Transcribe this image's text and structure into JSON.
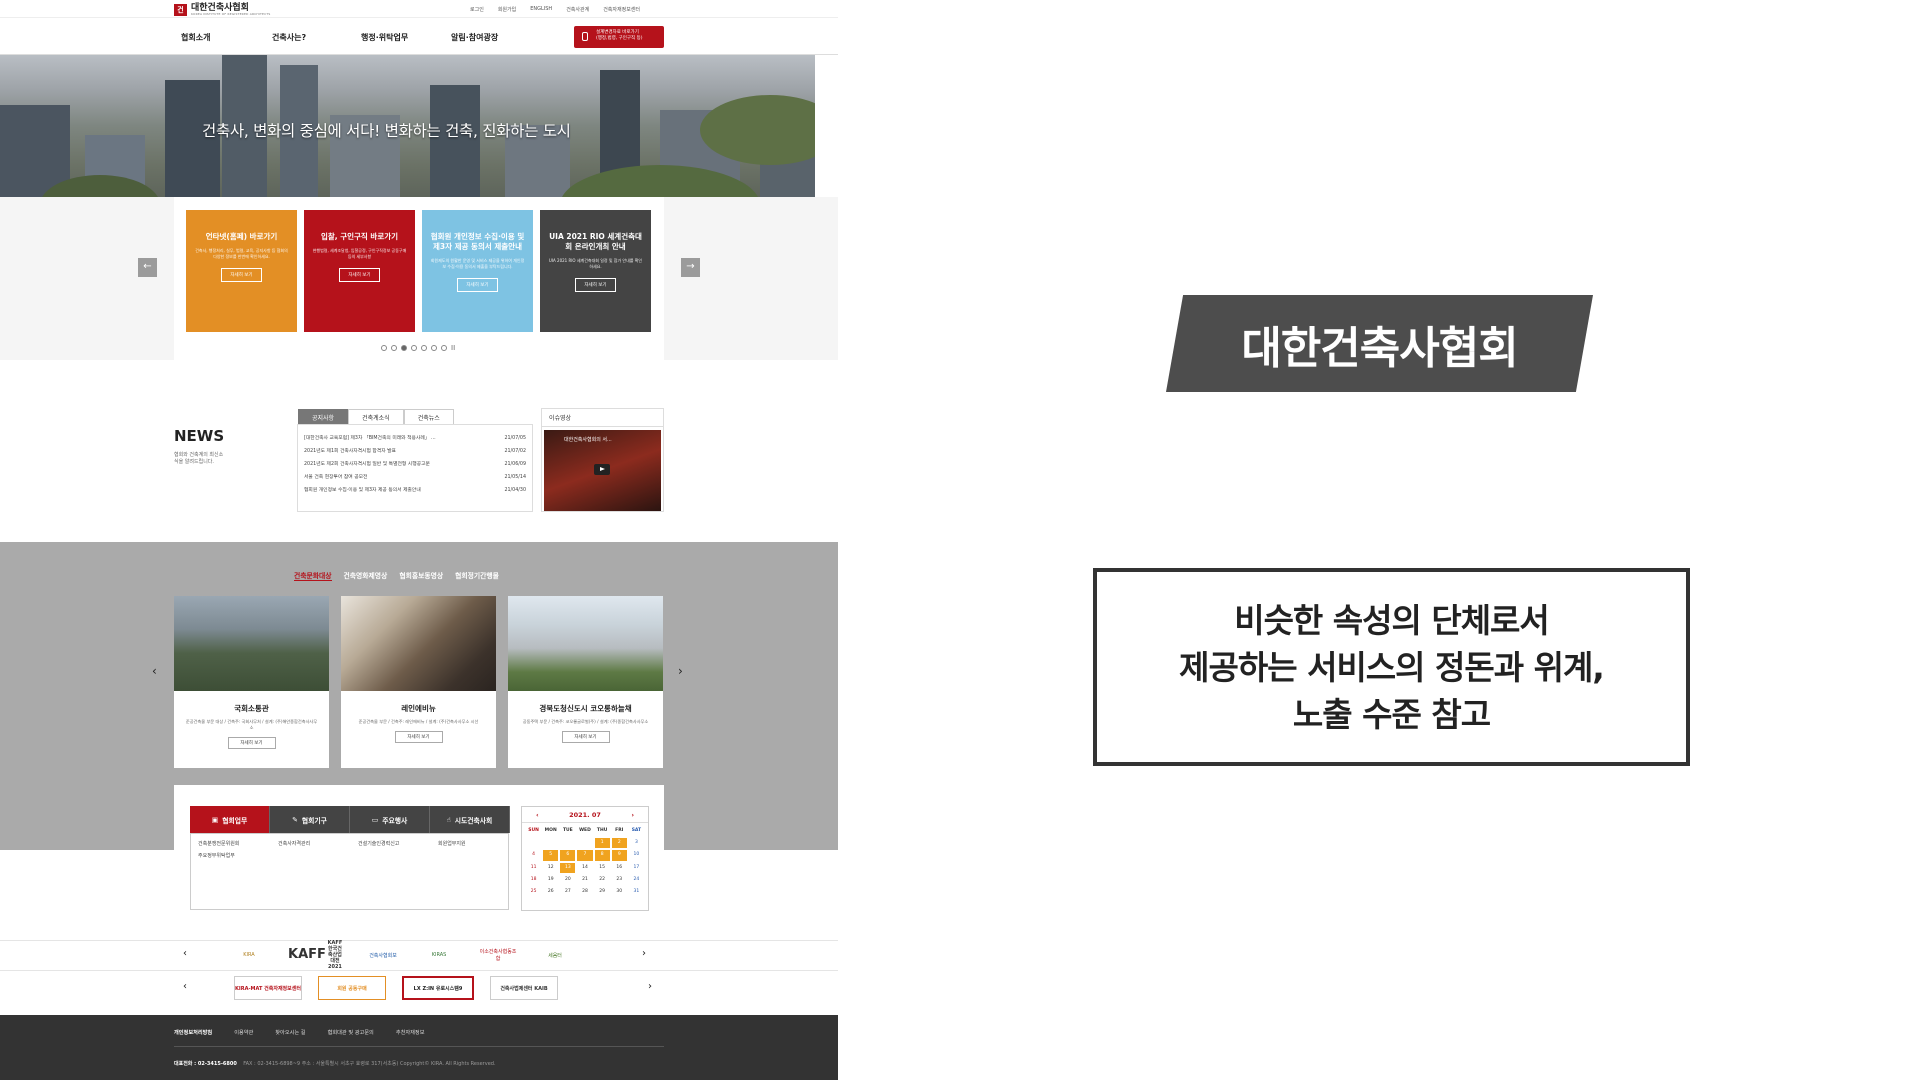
{
  "header": {
    "logo_title": "대한건축사협회",
    "logo_sub": "KOREA INSTITUTE OF REGISTERED ARCHITECTS",
    "utils": [
      "로그인",
      "회원가입",
      "ENGLISH",
      "건축사관계",
      "건축자재정보센터"
    ],
    "gnb": [
      "협회소개",
      "건축사는?",
      "행정·위탁업무",
      "알림·참여광장"
    ],
    "cta_line1": "설계변경자료 바로가기",
    "cta_line2": "(행정,법령, 구인구직 등)"
  },
  "hero": {
    "text": "건축사, 변화의 중심에 서다! 변화하는 건축, 진화하는 도시"
  },
  "cards": [
    {
      "title": "언타넷(홈페) 바로가기",
      "desc": "건축사, 행정처리, 실무, 법령, 교육, 공지사항 등 협회의 다양한 정보를 한번에 확인하세요.",
      "btn": "자세히 보기",
      "color": "#e38f25"
    },
    {
      "title": "입찰, 구인구직 바로가기",
      "desc": "현행법령, 세계조달청, 입찰공정, 구인구직정보 공동구매 등의 세부사항",
      "btn": "자세히 보기",
      "color": "#b5121b"
    },
    {
      "title": "협회원 개인정보 수집·이용 및 제3자 제공 동의서 제출안내",
      "desc": "회원제도의 원활한 운영 및 서비스 제공을 위하여 개인정보 수집·이용 동의서 제출을 부탁드립니다.",
      "btn": "자세히 보기",
      "color": "#7ec3e3"
    },
    {
      "title": "UIA 2021 RIO 세계건축대회 온라인개최 안내",
      "desc": "UIA 2021 RIO 세계건축대회 일정 및 참가 안내를 확인하세요.",
      "btn": "자세히 보기",
      "color": "#444444"
    }
  ],
  "slider": {
    "prev": "←",
    "next": "→",
    "pause": "II"
  },
  "news": {
    "heading": "NEWS",
    "desc": "협회와 건축계의 최신소식을 알려드립니다.",
    "tabs": [
      "공지사항",
      "건축계소식",
      "건축뉴스"
    ],
    "items": [
      {
        "title": "[대한건축사 교육포럼] 제3차 「BIM건축의 미래와 적용사례」 ...",
        "date": "21/07/05"
      },
      {
        "title": "2021년도 제1회 건축사자격시험 합격자 발표",
        "date": "21/07/02"
      },
      {
        "title": "2021년도 제2회 건축사자격시험 일반 및 특별전형 시행공고문",
        "date": "21/06/09"
      },
      {
        "title": "서울 건축 현장투어 참여 공모전",
        "date": "21/05/14"
      },
      {
        "title": "협회원 개인정보 수집·이용 및 제3자 제공 동의서 제출안내",
        "date": "21/04/30"
      }
    ],
    "issue_heading": "이슈영상",
    "video_title": "대한건축사협회의 서..."
  },
  "culture": {
    "tabs": [
      "건축문화대상",
      "건축영화제영상",
      "협회홍보동영상",
      "협회정기간행물"
    ],
    "cards": [
      {
        "title": "국회소통관",
        "desc": "준공건축물 부문 대상 / 건축주: 국회사무처 / 설계: (주)해안종합건축사사무소",
        "btn": "자세히 보기"
      },
      {
        "title": "레인에비뉴",
        "desc": "준공건축물 부문 / 건축주: 레인에비뉴 / 설계: (주)건축사사무소 시선",
        "btn": "자세히 보기"
      },
      {
        "title": "경북도청신도시 코오롱하늘채",
        "desc": "공동주택 부문 / 건축주: 코오롱글로벌(주) / 설계: (주)종합건축사사무소",
        "btn": "자세히 보기"
      }
    ],
    "prev": "‹",
    "next": "›"
  },
  "business": {
    "tabs": [
      "협회업무",
      "협회기구",
      "주요행사",
      "시도건축사회"
    ],
    "items": [
      "건축분쟁전문위원회",
      "건축사자격관리",
      "건설기술인경력신고",
      "회원업무지원",
      "주요정부위탁업무"
    ],
    "calendar": {
      "month": "2021. 07",
      "prev": "‹",
      "next": "›",
      "days": [
        "SUN",
        "MON",
        "TUE",
        "WED",
        "THU",
        "FRI",
        "SAT"
      ],
      "weeks": [
        [
          "",
          "",
          "",
          "",
          "1",
          "2",
          "3"
        ],
        [
          "4",
          "5",
          "6",
          "7",
          "8",
          "9",
          "10"
        ],
        [
          "11",
          "12",
          "13",
          "14",
          "15",
          "16",
          "17"
        ],
        [
          "18",
          "19",
          "20",
          "21",
          "22",
          "23",
          "24"
        ],
        [
          "25",
          "26",
          "27",
          "28",
          "29",
          "30",
          "31"
        ]
      ],
      "event_days": [
        "1",
        "2",
        "5",
        "6",
        "7",
        "8",
        "9",
        "13"
      ]
    }
  },
  "partners": {
    "row1": [
      "KIRA",
      "KAFF 한국건축산업대전 2021",
      "건축사협회보",
      "KIRAS",
      "이소건축사협동조합",
      "세움터"
    ],
    "row2": [
      "KIRA-MAT 건축자재정보센터",
      "회원 공동구매",
      "LX Z:IN 유로시스템9",
      "건축사법제센터 KAIB"
    ],
    "prev": "‹",
    "next": "›"
  },
  "footer": {
    "links": [
      "개인정보처리방침",
      "이용약관",
      "찾아오시는 길",
      "협회대관 및 광고문의",
      "추천자재정보"
    ],
    "tel": "대표전화 : 02-3415-6800",
    "info": "FAX : 02-3415-6898~9   주소 : 서울특별시 서초구 효령로 317(서초동) Copyright© KIRA. All Rights Reserved."
  },
  "slide_title": "대한건축사협회",
  "note": {
    "line1": "비슷한 속성의 단체로서",
    "line2": "제공하는 서비스의 정돈과 위계,",
    "line3": "노출 수준 참고"
  }
}
